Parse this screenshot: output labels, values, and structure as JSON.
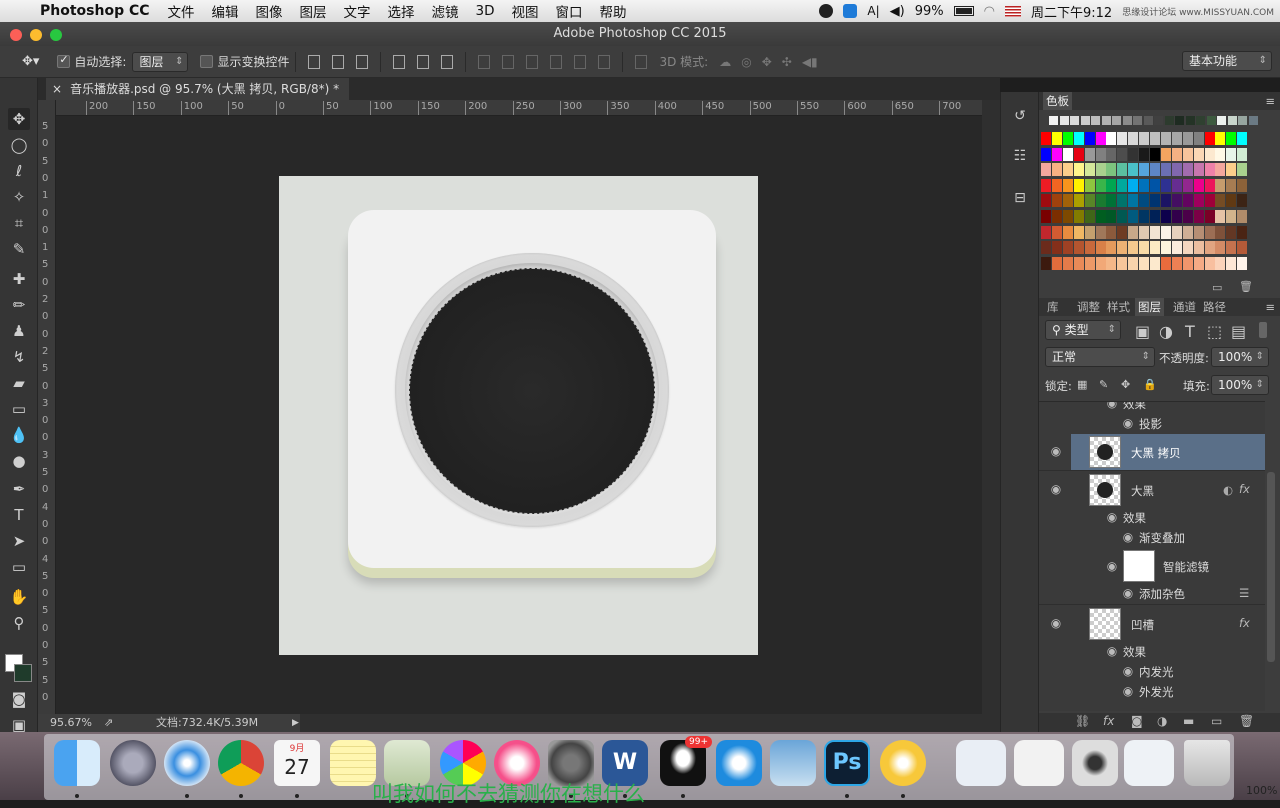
{
  "menubar": {
    "app_name": "Photoshop CC",
    "menus": [
      "文件",
      "编辑",
      "图像",
      "图层",
      "文字",
      "选择",
      "滤镜",
      "3D",
      "视图",
      "窗口",
      "帮助"
    ],
    "battery": "99%",
    "clock": "周二下午9:12",
    "watermark": "思缘设计论坛 www.MISSYUAN.COM"
  },
  "window": {
    "title": "Adobe Photoshop CC 2015"
  },
  "options": {
    "auto_select_label": "自动选择:",
    "auto_select_value": "图层",
    "show_transform_label": "显示变换控件",
    "mode_3d_label": "3D 模式:",
    "workspace": "基本功能"
  },
  "document": {
    "tab_title": "音乐播放器.psd @ 95.7% (大黑 拷贝, RGB/8*) *",
    "zoom": "95.67%",
    "doc_info": "文档:732.4K/5.39M"
  },
  "rulers": {
    "h_ticks": [
      "200",
      "150",
      "100",
      "50",
      "0",
      "50",
      "100",
      "150",
      "200",
      "250",
      "300",
      "350",
      "400",
      "450",
      "500",
      "550",
      "600",
      "650",
      "700"
    ],
    "v_ticks": [
      "5",
      "0",
      "5",
      "0",
      "1",
      "0",
      "0",
      "1",
      "5",
      "0",
      "2",
      "0",
      "0",
      "2",
      "5",
      "0",
      "3",
      "0",
      "0",
      "3",
      "5",
      "0",
      "4",
      "0",
      "0",
      "4",
      "5",
      "0",
      "5",
      "0",
      "0",
      "5",
      "5",
      "0"
    ]
  },
  "swatches_panel": {
    "title": "色板"
  },
  "layers_panel": {
    "tabs": [
      "库",
      "调整",
      "样式",
      "图层",
      "通道",
      "路径"
    ],
    "active_tab": "图层",
    "filter_kind": "类型",
    "blend_mode": "正常",
    "opacity_label": "不透明度:",
    "opacity": "100%",
    "lock_label": "锁定:",
    "fill_label": "填充:",
    "fill": "100%",
    "rows": [
      {
        "name": "效果",
        "type": "sub-header"
      },
      {
        "name": "投影",
        "type": "effect"
      },
      {
        "name": "大黑 拷贝",
        "type": "layer",
        "selected": true
      },
      {
        "name": "大黑",
        "type": "layer",
        "fx": "fx"
      },
      {
        "name": "效果",
        "type": "sub-header"
      },
      {
        "name": "渐变叠加",
        "type": "effect"
      },
      {
        "name": "智能滤镜",
        "type": "smart-filter"
      },
      {
        "name": "添加杂色",
        "type": "effect"
      },
      {
        "name": "凹槽",
        "type": "layer",
        "fx": "fx"
      },
      {
        "name": "效果",
        "type": "sub-header"
      },
      {
        "name": "内发光",
        "type": "effect"
      },
      {
        "name": "外发光",
        "type": "effect"
      }
    ]
  },
  "dock": {
    "calendar_month": "9月",
    "calendar_day": "27",
    "qq_badge": "99+",
    "ps_label": "Ps",
    "word_label": "W",
    "trash_label": "100%"
  },
  "caption": "叫我如何不去猜测你在想什么",
  "colors": {
    "accent_selected": "#5a6f88",
    "artboard": "#dcdfdb",
    "card": "#f2f2f2",
    "disc": "#222222"
  }
}
